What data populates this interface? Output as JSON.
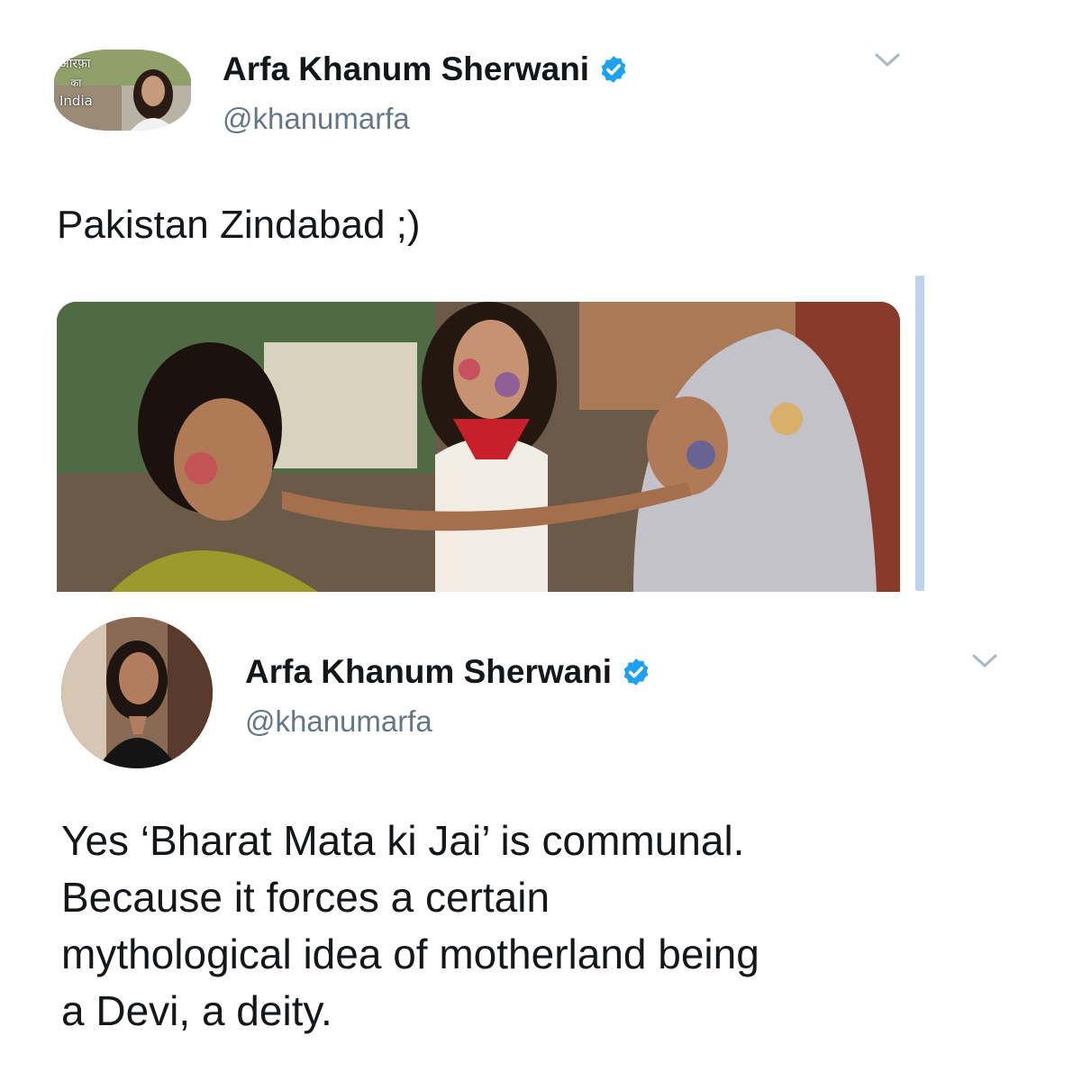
{
  "tweets": [
    {
      "author_name": "Arfa Khanum Sherwani",
      "handle": "@khanumarfa",
      "text": "Pakistan Zindabad ;)",
      "avatar_text": {
        "line1": "आरफ़ा",
        "line2": "का",
        "line3": "India"
      },
      "verified": true,
      "has_media": true
    },
    {
      "author_name": "Arfa Khanum Sherwani",
      "handle": "@khanumarfa",
      "text_lines": [
        "Yes ‘Bharat Mata ki Jai’ is communal.",
        "Because it forces a certain",
        "mythological idea of motherland being",
        "a Devi, a deity."
      ],
      "verified": true,
      "has_media": false
    }
  ],
  "colors": {
    "text": "#14171a",
    "handle": "#657786",
    "verified_blue": "#1da1f2",
    "chevron": "#aab8c2"
  },
  "icons": {
    "verified": "verified-badge-icon",
    "menu": "chevron-down-icon"
  }
}
